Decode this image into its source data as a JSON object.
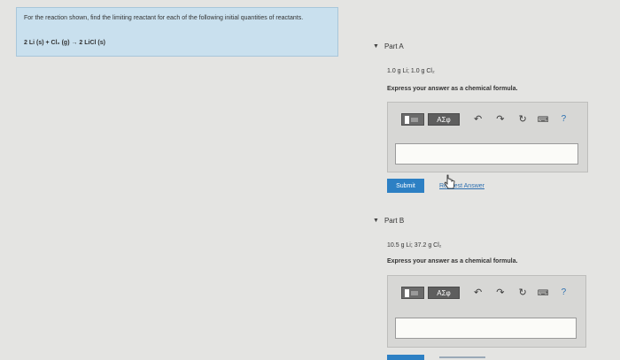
{
  "problem": {
    "text": "For the reaction shown, find the limiting reactant for each of the following initial quantities of reactants.",
    "equation": "2 Li (s) + Cl₂ (g) → 2 LiCl (s)"
  },
  "parts": [
    {
      "title": "Part A",
      "quantities": "1.0 g Li; 1.0 g Cl₂",
      "prompt": "Express your answer as a chemical formula.",
      "greek_label": "ΑΣφ",
      "answer_value": "",
      "submit_label": "Submit",
      "request_label": "Request Answer"
    },
    {
      "title": "Part B",
      "quantities": "10.5 g Li; 37.2 g Cl₂",
      "prompt": "Express your answer as a chemical formula.",
      "greek_label": "ΑΣφ",
      "answer_value": ""
    }
  ],
  "colors": {
    "problem_bg": "#c9e0ee",
    "submit_bg": "#2d80c4",
    "help": "#2a6fb0"
  },
  "icons": [
    "templates-icon",
    "greek-symbols-icon",
    "undo-icon",
    "redo-icon",
    "reset-icon",
    "keyboard-icon",
    "help-icon"
  ]
}
